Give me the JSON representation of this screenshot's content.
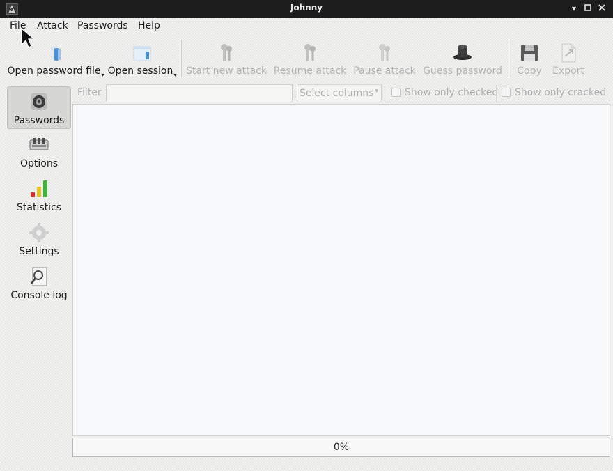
{
  "window": {
    "title": "Johnny"
  },
  "menu": [
    "File",
    "Attack",
    "Passwords",
    "Help"
  ],
  "toolbar": {
    "open_password_file": "Open password file",
    "open_session": "Open session",
    "start_new_attack": "Start new attack",
    "resume_attack": "Resume attack",
    "pause_attack": "Pause attack",
    "guess_password": "Guess password",
    "copy": "Copy",
    "export": "Export"
  },
  "nav": {
    "passwords": "Passwords",
    "options": "Options",
    "statistics": "Statistics",
    "settings": "Settings",
    "console_log": "Console log"
  },
  "filter": {
    "label": "Filter",
    "value": "",
    "select_columns": "Select columns",
    "show_only_checked": "Show only checked",
    "show_only_cracked": "Show only cracked"
  },
  "progress": {
    "value": 0,
    "text": "0%"
  },
  "colors": {
    "titlebar": "#1d1d1d",
    "accent_blue": "#4a90d9",
    "stat_red": "#d9302a",
    "stat_yellow": "#e8c21e",
    "stat_green": "#3fb33a"
  },
  "icons": {
    "app": "john-logo-icon",
    "open_file": "folder-open-icon",
    "open_session": "window-icon",
    "start": "keys-icon",
    "resume": "keys-icon",
    "pause": "keys-icon",
    "guess": "top-hat-icon",
    "copy": "floppy-disk-icon",
    "export": "export-document-icon",
    "passwords": "safe-dial-icon",
    "options": "sliders-icon",
    "statistics": "bar-signal-icon",
    "settings": "gear-icon",
    "console": "magnifier-log-icon"
  }
}
